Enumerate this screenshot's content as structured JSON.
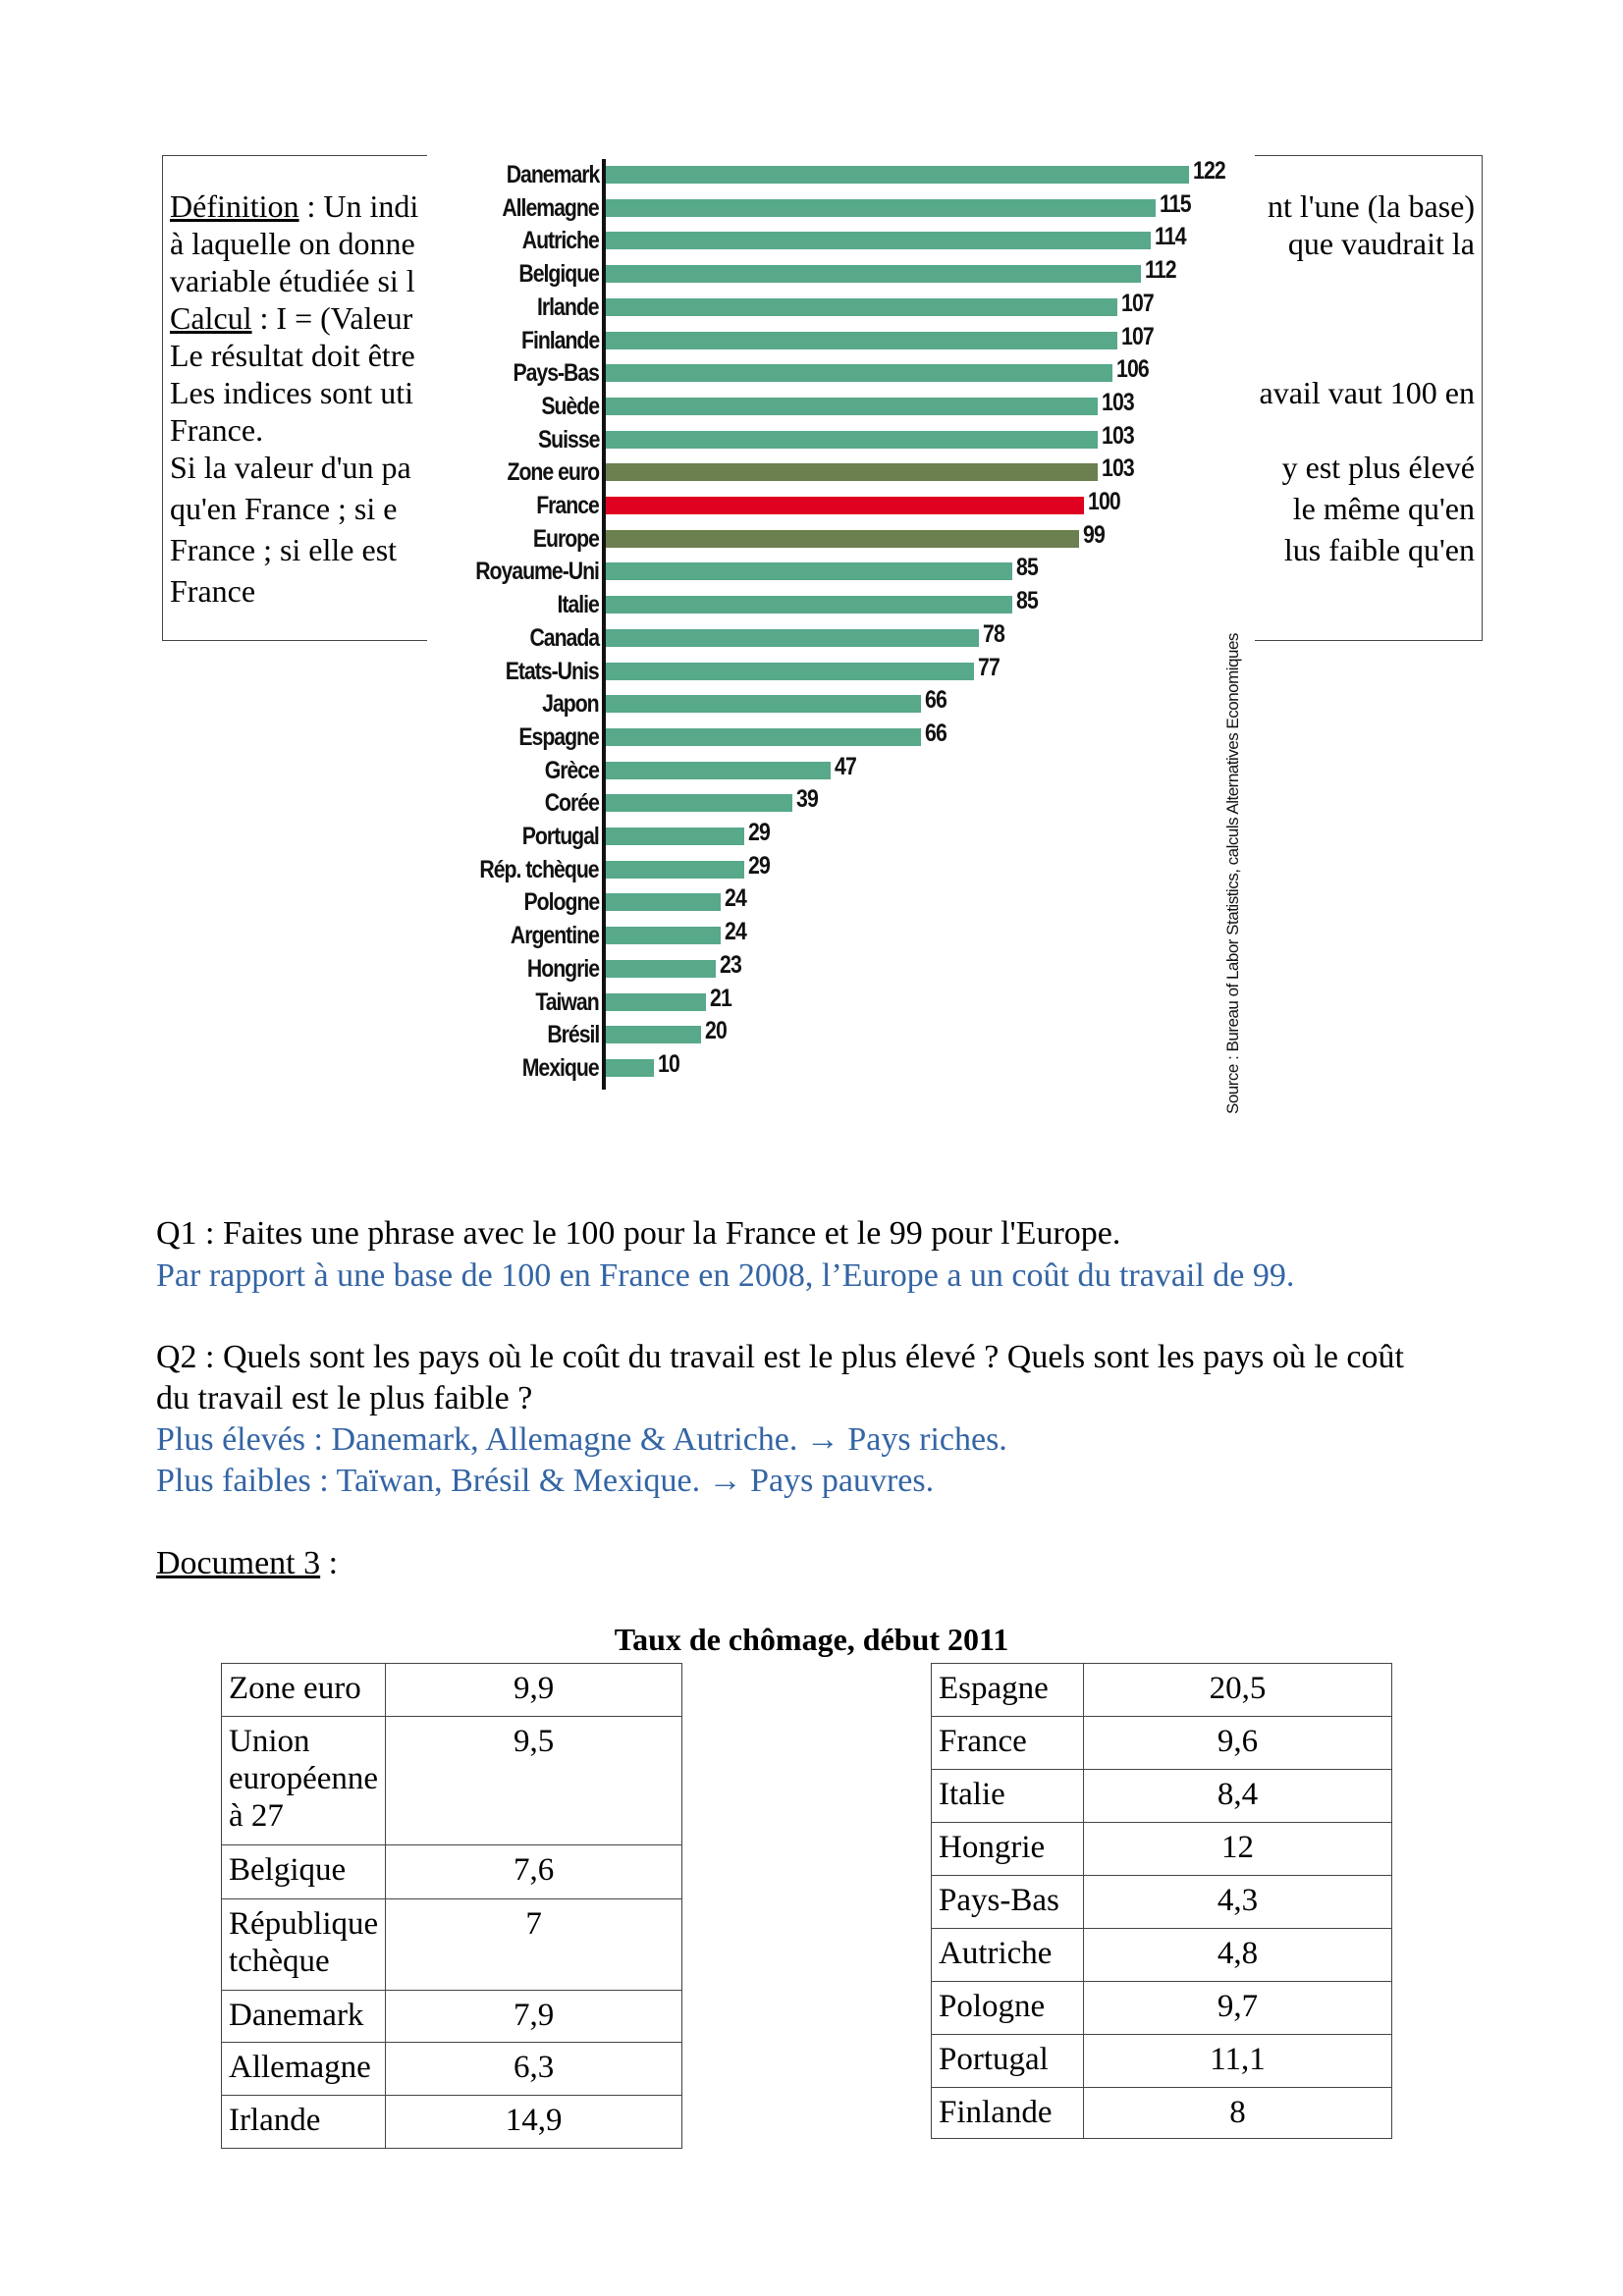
{
  "definition_box": {
    "left_lines": [
      {
        "label": "Définition",
        "text": " : Un indi"
      },
      {
        "text": "à laquelle on donne"
      },
      {
        "text": "variable étudiée si l"
      },
      {
        "label": "Calcul",
        "text": " : I = (Valeur"
      },
      {
        "text": "Le résultat doit être"
      },
      {
        "text": "Les indices sont uti"
      },
      {
        "text": "France."
      },
      {
        "text": "Si la valeur d'un pa"
      },
      {
        "text": "qu'en France ; si e"
      },
      {
        "text": "France ; si elle est"
      },
      {
        "text": "France"
      }
    ],
    "right_lines": [
      {
        "line": 0,
        "text": "nt l'une (la base)"
      },
      {
        "line": 1,
        "text": "que vaudrait la"
      },
      {
        "line": 5,
        "text": "avail vaut 100 en"
      },
      {
        "line": 7,
        "text": "y est plus élevé"
      },
      {
        "line": 8,
        "text": "le même qu'en"
      },
      {
        "line": 9,
        "text": "lus faible qu'en"
      }
    ]
  },
  "chart_data": {
    "type": "bar",
    "orientation": "horizontal",
    "categories": [
      "Danemark",
      "Allemagne",
      "Autriche",
      "Belgique",
      "Irlande",
      "Finlande",
      "Pays-Bas",
      "Suède",
      "Suisse",
      "Zone euro",
      "France",
      "Europe",
      "Royaume-Uni",
      "Italie",
      "Canada",
      "Etats-Unis",
      "Japon",
      "Espagne",
      "Grèce",
      "Corée",
      "Portugal",
      "Rép. tchèque",
      "Pologne",
      "Argentine",
      "Hongrie",
      "Taiwan",
      "Brésil",
      "Mexique"
    ],
    "values": [
      122,
      115,
      114,
      112,
      107,
      107,
      106,
      103,
      103,
      103,
      100,
      99,
      85,
      85,
      78,
      77,
      66,
      66,
      47,
      39,
      29,
      29,
      24,
      24,
      23,
      21,
      20,
      10
    ],
    "highlight": {
      "France": "#e0001f",
      "Zone euro": "#6b7f4f",
      "Europe": "#6b7f4f"
    },
    "default_color": "#58a88a",
    "xlim": [
      0,
      122
    ],
    "source": "Source : Bureau of Labor Statistics, calculs Alternatives Economiques"
  },
  "questions": {
    "q1": "Q1 : Faites une phrase avec le 100 pour la France et le 99 pour l'Europe.",
    "a1": "Par rapport à une base de 100 en France en 2008, l’Europe a un coût du travail de 99.",
    "q2_line1": "Q2 : Quels sont les pays où le coût du travail est le plus élevé ? Quels sont les pays où le coût",
    "q2_line2": "du travail est le plus faible ?",
    "a2_line1": "Plus élevés : Danemark, Allemagne & Autriche. → Pays riches.",
    "a2_line2": "Plus faibles : Taïwan, Brésil & Mexique. → Pays pauvres."
  },
  "document3": {
    "label": "Document 3",
    "suffix": " :"
  },
  "unemployment": {
    "title": "Taux de chômage, début 2011",
    "left": [
      {
        "country": [
          "Zone euro"
        ],
        "value": "9,9"
      },
      {
        "country": [
          "Union",
          "européenne",
          "à 27"
        ],
        "value": "9,5"
      },
      {
        "country": [
          "Belgique"
        ],
        "value": "7,6"
      },
      {
        "country": [
          "République",
          "tchèque"
        ],
        "value": "7"
      },
      {
        "country": [
          "Danemark"
        ],
        "value": "7,9"
      },
      {
        "country": [
          "Allemagne"
        ],
        "value": "6,3"
      },
      {
        "country": [
          "Irlande"
        ],
        "value": "14,9"
      }
    ],
    "right": [
      {
        "country": [
          "Espagne"
        ],
        "value": "20,5"
      },
      {
        "country": [
          "France"
        ],
        "value": "9,6"
      },
      {
        "country": [
          "Italie"
        ],
        "value": "8,4"
      },
      {
        "country": [
          "Hongrie"
        ],
        "value": "12"
      },
      {
        "country": [
          "Pays-Bas"
        ],
        "value": "4,3"
      },
      {
        "country": [
          "Autriche"
        ],
        "value": "4,8"
      },
      {
        "country": [
          "Pologne"
        ],
        "value": "9,7"
      },
      {
        "country": [
          "Portugal"
        ],
        "value": "11,1"
      },
      {
        "country": [
          "Finlande"
        ],
        "value": "8"
      }
    ]
  }
}
